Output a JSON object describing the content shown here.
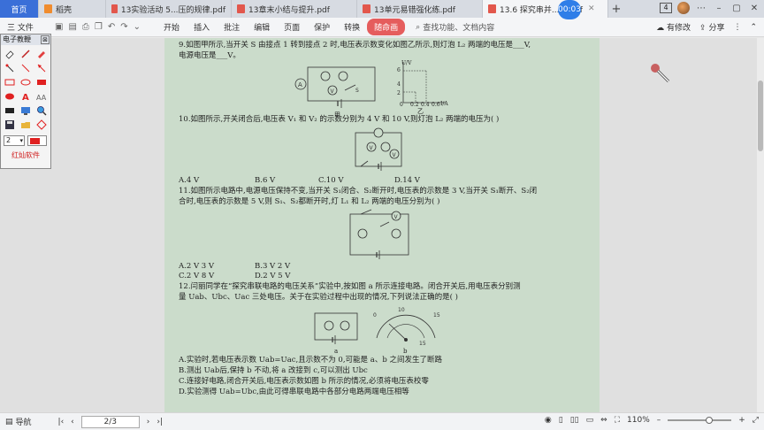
{
  "tabs": [
    {
      "label": "首页",
      "kind": "home"
    },
    {
      "label": "稻壳",
      "kind": "docer"
    },
    {
      "label": "13实验活动 5...压的规律.pdf",
      "kind": "pdf"
    },
    {
      "label": "13章末小结与提升.pdf",
      "kind": "pdf"
    },
    {
      "label": "13单元易错强化练.pdf",
      "kind": "pdf"
    },
    {
      "label": "13.6 探究串并...压.pdf",
      "kind": "pdf",
      "active": true
    }
  ],
  "titlebar": {
    "window_count": "4",
    "add": "+"
  },
  "timer": "00:03",
  "toolbar": {
    "file_menu": "三 文件",
    "menu": [
      "开始",
      "插入",
      "批注",
      "编辑",
      "页面",
      "保护",
      "转换",
      "随命画"
    ],
    "active_menu": "随命画",
    "search": "查找功能、文档内容",
    "has_changes": "有修改",
    "share": "分享"
  },
  "panel": {
    "title": "电子教鞭",
    "close": "⊠",
    "size_value": "2",
    "brand": "红灿软件"
  },
  "questions": {
    "q9_l1": "9.如图甲所示,当开关 S 由接点 1 转到接点 2 时,电压表示数变化如图乙所示,则灯泡 L₂ 两端的电压是___V,",
    "q9_l2": "电源电压是___V。",
    "q9_jia": "甲",
    "q9_yi": "乙",
    "q9_axis_y": "U/V",
    "q9_axis_x": "I/A",
    "q9_ticks_y": [
      "6",
      "4",
      "2"
    ],
    "q9_ticks_x": [
      "0",
      "0.2",
      "0.4",
      "0.6"
    ],
    "q10": "10.如图所示,开关闭合后,电压表 V₁ 和 V₂ 的示数分别为 4 V 和 10 V,则灯泡 L₂ 两端的电压为(     )",
    "q10_a": "A.4 V",
    "q10_b": "B.6 V",
    "q10_c": "C.10 V",
    "q10_d": "D.14 V",
    "q11_l1": "11.如图所示电路中,电源电压保持不变,当开关 S₁闭合、S₂断开时,电压表的示数是 3 V,当开关 S₁断开、S₂闭",
    "q11_l2": "合时,电压表的示数是 5 V,则 S₁、S₂都断开时,灯 L₁ 和 L₂ 两端的电压分别为(     )",
    "q11_a": "A.2 V    3 V",
    "q11_b": "B.3 V    2 V",
    "q11_c": "C.2 V    8 V",
    "q11_d": "D.2 V    5 V",
    "q12_l1": "12.闫丽同学在“探究串联电路的电压关系”实验中,按如图 a 所示连接电路。闭合开关后,用电压表分别测",
    "q12_l2": "量 Uab、Ubc、Uac 三处电压。关于在实验过程中出现的情况,下列说法正确的是(     )",
    "q12_a_label": "a",
    "q12_b_label": "b",
    "q12_opt_a": "A.实验时,若电压表示数 Uab=Uac,且示数不为 0,可能是 a、b 之间发生了断路",
    "q12_opt_b": "B.测出 Uab后,保持 b 不动,将 a 改接到 c,可以测出 Ubc",
    "q12_opt_c": "C.连接好电路,闭合开关后,电压表示数如图 b 所示的情况,必须将电压表校零",
    "q12_opt_d": "D.实验测得 Uab=Ubc,由此可得串联电路中各部分电路两端电压相等"
  },
  "statusbar": {
    "nav": "导航",
    "page": "2/3",
    "zoom": "110%"
  }
}
